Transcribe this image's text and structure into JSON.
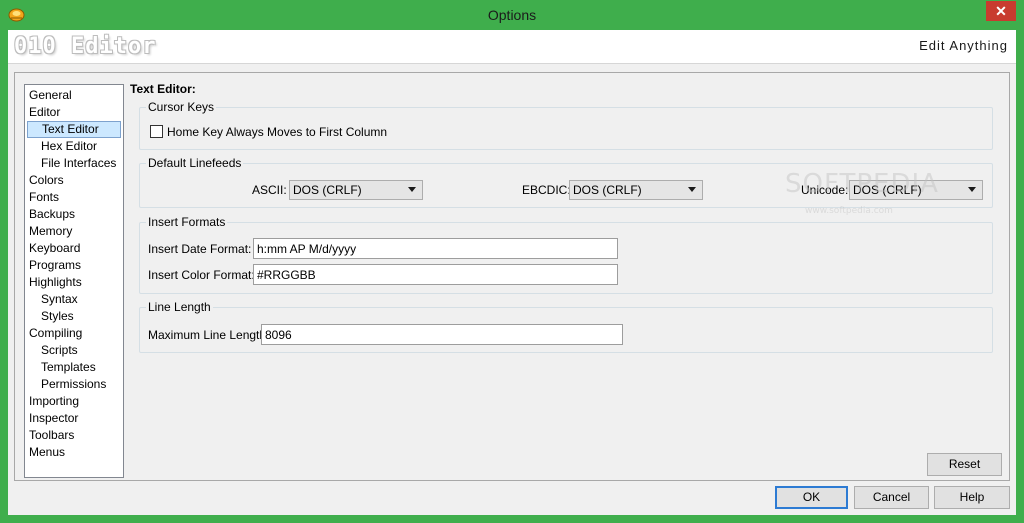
{
  "window": {
    "title": "Options",
    "close_glyph": "✕"
  },
  "header": {
    "brand": "010 Editor",
    "tagline": "Edit Anything"
  },
  "nav": {
    "items": [
      {
        "label": "General"
      },
      {
        "label": "Editor"
      },
      {
        "label": "Text Editor"
      },
      {
        "label": "Hex Editor"
      },
      {
        "label": "File Interfaces"
      },
      {
        "label": "Colors"
      },
      {
        "label": "Fonts"
      },
      {
        "label": "Backups"
      },
      {
        "label": "Memory"
      },
      {
        "label": "Keyboard"
      },
      {
        "label": "Programs"
      },
      {
        "label": "Highlights"
      },
      {
        "label": "Syntax"
      },
      {
        "label": "Styles"
      },
      {
        "label": "Compiling"
      },
      {
        "label": "Scripts"
      },
      {
        "label": "Templates"
      },
      {
        "label": "Permissions"
      },
      {
        "label": "Importing"
      },
      {
        "label": "Inspector"
      },
      {
        "label": "Toolbars"
      },
      {
        "label": "Menus"
      }
    ],
    "selected": "Text Editor"
  },
  "content": {
    "section_title": "Text Editor:",
    "cursor_keys": {
      "legend": "Cursor Keys",
      "home_key_label": "Home Key Always Moves to First Column",
      "home_key_checked": false
    },
    "linefeeds": {
      "legend": "Default Linefeeds",
      "ascii_label": "ASCII:",
      "ascii_value": "DOS (CRLF)",
      "ebcdic_label": "EBCDIC:",
      "ebcdic_value": "DOS (CRLF)",
      "unicode_label": "Unicode:",
      "unicode_value": "DOS (CRLF)"
    },
    "insert_formats": {
      "legend": "Insert Formats",
      "date_label": "Insert Date Format:",
      "date_value": "h:mm AP M/d/yyyy",
      "color_label": "Insert Color Format:",
      "color_value": "#RRGGBB"
    },
    "line_length": {
      "legend": "Line Length",
      "max_label": "Maximum Line Length:",
      "max_value": "8096"
    }
  },
  "buttons": {
    "reset": "Reset",
    "ok": "OK",
    "cancel": "Cancel",
    "help": "Help"
  },
  "watermark": {
    "logo": "SOFTPEDIA",
    "url": "www.softpedia.com"
  },
  "colors": {
    "titlebar": "#3fae4c",
    "close_button": "#c83b2f",
    "selection": "#cce8ff",
    "default_button_border": "#2d7bd3"
  },
  "icons": {
    "app": "010-editor-app-icon",
    "close": "close-icon",
    "dropdown": "chevron-down-icon"
  }
}
